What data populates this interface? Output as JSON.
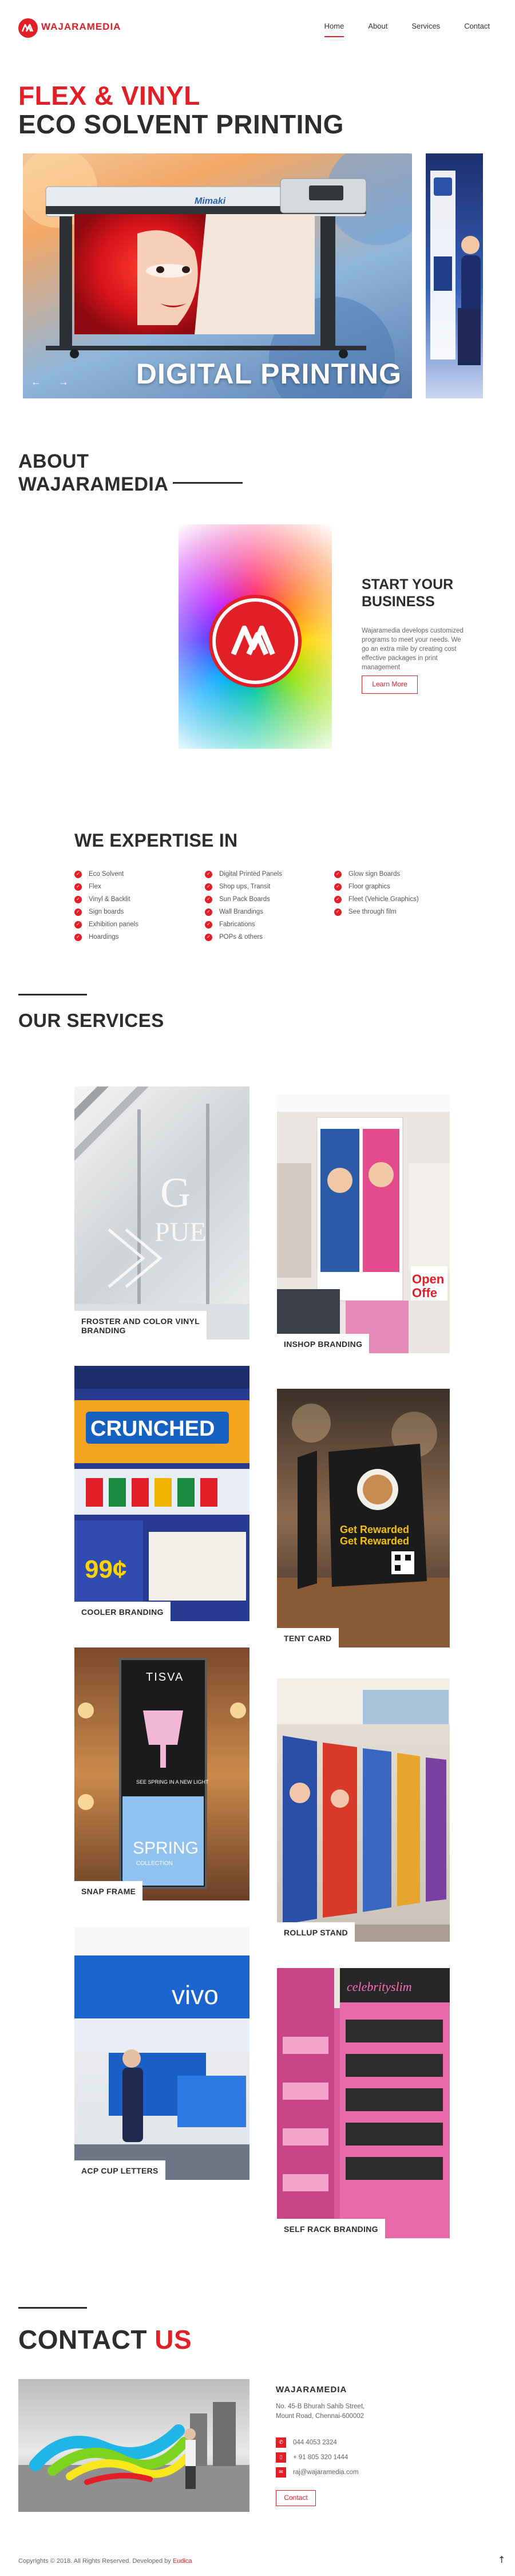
{
  "brand": {
    "name": "WAJARAMEDIA",
    "accent": "#e21f26",
    "dark": "#2d2d2d",
    "logo_icon": "wajaramedia-logo-icon"
  },
  "nav": {
    "items": [
      "Home",
      "About",
      "Services",
      "Contact"
    ],
    "active": "Home"
  },
  "hero": {
    "title_line1": "FLEX & VINYL",
    "title_line2": "ECO SOLVENT PRINTING",
    "slide_caption": "DIGITAL PRINTING",
    "printer_brand": "Mimaki",
    "prev_icon": "arrow-left-icon",
    "next_icon": "arrow-right-icon"
  },
  "about": {
    "title_line1": "ABOUT",
    "title_line2": "WAJARAMEDIA",
    "heading_line1": "START YOUR",
    "heading_line2": "BUSINESS",
    "text": "Wajaramedia develops customized programs to meet your needs. We go an extra mile by creating cost effective packages in print management",
    "button": "Learn More"
  },
  "expertise": {
    "title": "WE EXPERTISE IN",
    "col1": [
      "Eco Solvent",
      "Flex",
      "Vinyl & Backlit",
      "Sign boards",
      "Exhibition panels",
      "Hoardings"
    ],
    "col2": [
      "Digital Printed Panels",
      "Shop ups, Transit",
      "Sun Pack Boards",
      "Wall Brandings",
      "Fabrications",
      "POPs & others"
    ],
    "col3": [
      "Glow sign Boards",
      "Floor graphics",
      "Fleet (Vehicle Graphics)",
      "See through film"
    ]
  },
  "services": {
    "title": "OUR SERVICES",
    "cards": [
      {
        "label_line1": "FROSTER AND COLOR VINYL",
        "label_line2": "BRANDING"
      },
      {
        "label_line1": "INSHOP BRANDING",
        "label_line2": ""
      },
      {
        "label_line1": "COOLER BRANDING",
        "label_line2": ""
      },
      {
        "label_line1": "TENT CARD",
        "label_line2": ""
      },
      {
        "label_line1": "SNAP FRAME",
        "label_line2": ""
      },
      {
        "label_line1": "ROLLUP STAND",
        "label_line2": ""
      },
      {
        "label_line1": "ACP CUP LETTERS",
        "label_line2": ""
      },
      {
        "label_line1": "SELF RACK BRANDING",
        "label_line2": ""
      }
    ],
    "cooler_text": "CRUNCHED",
    "cooler_price": "99¢",
    "tent_text_1": "Get Rewarded",
    "tent_text_2": "Get Rewarded",
    "tent_offer": "Oper Offe",
    "snap_brand": "TISVA",
    "snap_line": "SEE SPRING IN A NEW LIGHT",
    "snap_spring": "SPRING",
    "snap_collection": "COLLECTION",
    "acp_brand": "vivo",
    "rack_brand": "celebrityslim"
  },
  "contact": {
    "title_a": "CONTACT",
    "title_b": "US",
    "company": "WAJARAMEDIA",
    "address_line1": "No. 45-B Bhurah Sahib Street,",
    "address_line2": "Mount Road, Chennai-600002",
    "phone1": "044 4053 2324",
    "phone2": "+ 91 805 320 1444",
    "email": "raj@wajaramedia.com",
    "phone_icon": "phone-icon",
    "mobile_icon": "mobile-icon",
    "email_icon": "email-icon",
    "button": "Contact"
  },
  "footer": {
    "text": "Copyrights © 2018. All Rights Reserved. Developed by",
    "developer": "Eudica",
    "top_icon": "arrow-up-icon"
  }
}
